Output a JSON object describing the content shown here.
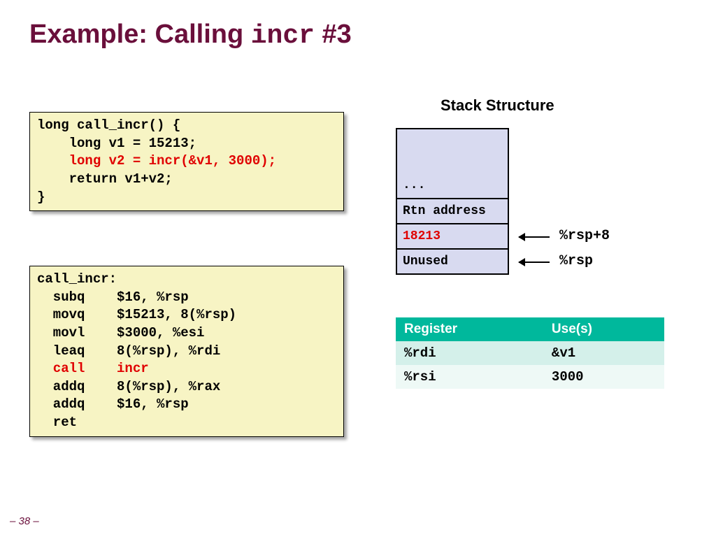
{
  "title": {
    "prefix": "Example: Calling ",
    "mono": "incr",
    "suffix": " #3"
  },
  "code1": {
    "l1": "long call_incr() {",
    "l2": "    long v1 = 15213;",
    "l3": "    long v2 = incr(&v1, 3000);",
    "l4": "    return v1+v2;",
    "l5": "}"
  },
  "code2": {
    "l1": "call_incr:",
    "l2": "  subq    $16, %rsp",
    "l3": "  movq    $15213, 8(%rsp)",
    "l4": "  movl    $3000, %esi",
    "l5": "  leaq    8(%rsp), %rdi",
    "l6": "  call    incr",
    "l7": "  addq    8(%rsp), %rax",
    "l8": "  addq    $16, %rsp",
    "l9": "  ret"
  },
  "stack": {
    "title": "Stack Structure",
    "cells": [
      "...",
      "Rtn address",
      "18213",
      "Unused"
    ],
    "ptr1": "%rsp+8",
    "ptr2": "%rsp"
  },
  "registers": {
    "headers": [
      "Register",
      "Use(s)"
    ],
    "rows": [
      {
        "reg": "%rdi",
        "use": "&v1"
      },
      {
        "reg": "%rsi",
        "use": "3000"
      }
    ]
  },
  "page": "– 38 –"
}
